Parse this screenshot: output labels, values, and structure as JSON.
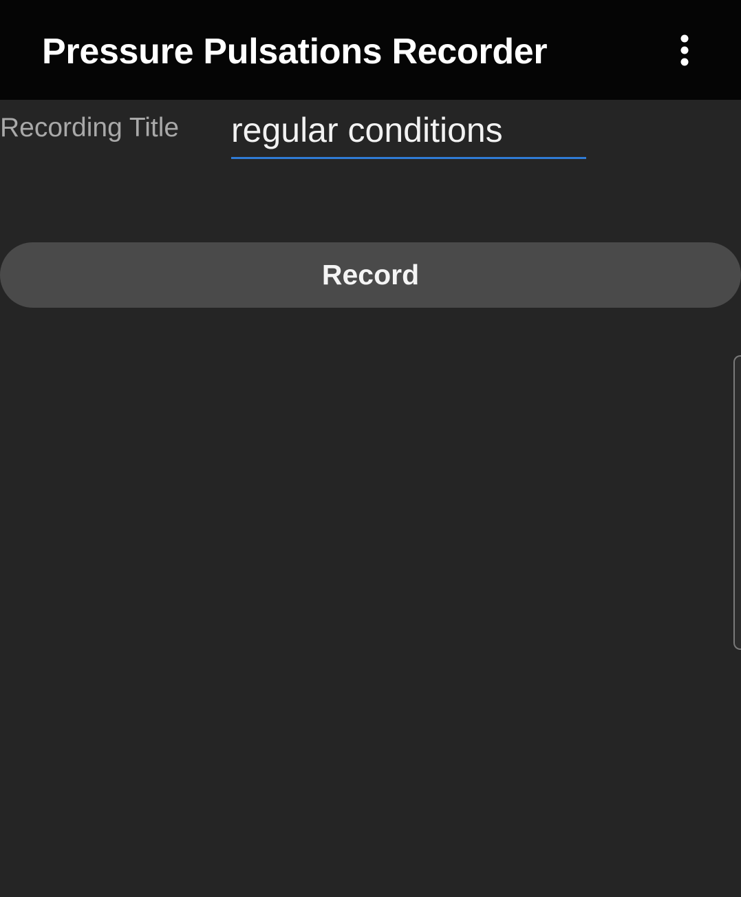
{
  "app_bar": {
    "title": "Pressure Pulsations Recorder",
    "overflow_icon": "more-vertical-icon"
  },
  "form": {
    "recording_title_label": "Recording Title",
    "recording_title_value": "regular conditions"
  },
  "record_button": {
    "label": "Record"
  },
  "colors": {
    "app_bar_background": "#050505",
    "screen_background": "#252525",
    "input_underline_accent": "#2f7bd6",
    "button_background": "#4a4a4a"
  }
}
